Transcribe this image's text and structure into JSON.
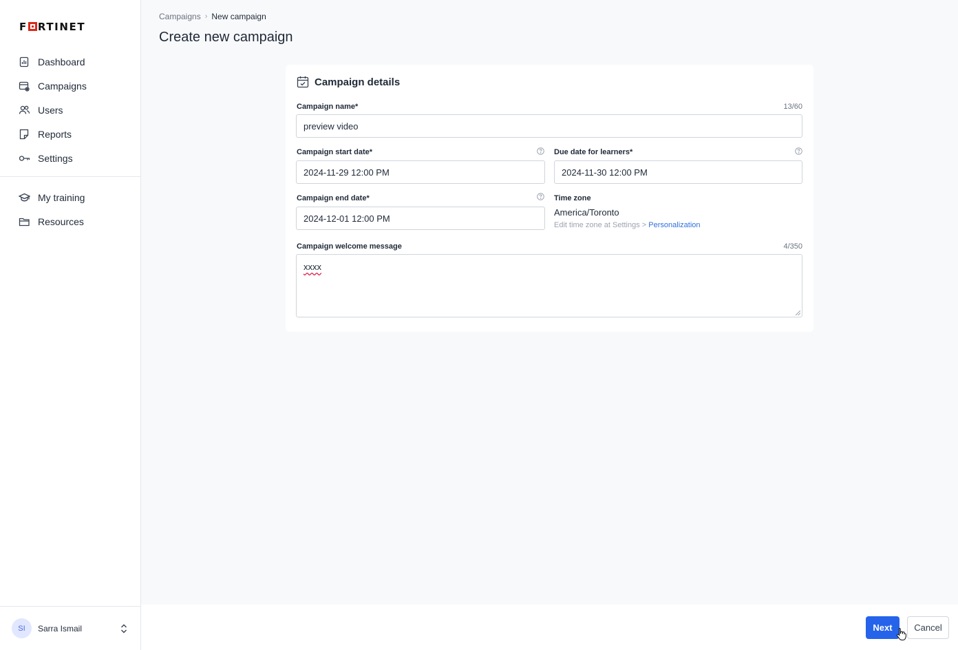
{
  "brand": {
    "logo_text": "FORTINET",
    "accent": "#da291c"
  },
  "sidebar": {
    "items": [
      {
        "label": "Dashboard",
        "icon": "dashboard-icon"
      },
      {
        "label": "Campaigns",
        "icon": "campaigns-icon"
      },
      {
        "label": "Users",
        "icon": "users-icon"
      },
      {
        "label": "Reports",
        "icon": "reports-icon"
      },
      {
        "label": "Settings",
        "icon": "key-icon"
      }
    ],
    "secondary_items": [
      {
        "label": "My training",
        "icon": "graduation-cap-icon"
      },
      {
        "label": "Resources",
        "icon": "folder-icon"
      }
    ],
    "user": {
      "initials": "SI",
      "name": "Sarra Ismail"
    }
  },
  "breadcrumb": {
    "parent": "Campaigns",
    "current": "New campaign"
  },
  "page_title": "Create new campaign",
  "card": {
    "title": "Campaign details",
    "campaign_name": {
      "label": "Campaign name*",
      "value": "preview video",
      "counter": "13/60"
    },
    "start_date": {
      "label": "Campaign start date*",
      "value": "2024-11-29 12:00 PM"
    },
    "due_date": {
      "label": "Due date for learners*",
      "value": "2024-11-30 12:00 PM"
    },
    "end_date": {
      "label": "Campaign end date*",
      "value": "2024-12-01 12:00 PM"
    },
    "time_zone": {
      "label": "Time zone",
      "value": "America/Toronto",
      "hint_prefix": "Edit time zone at Settings > ",
      "hint_link": "Personalization"
    },
    "welcome_message": {
      "label": "Campaign welcome message",
      "value": "xxxx",
      "counter": "4/350"
    }
  },
  "footer": {
    "next_label": "Next",
    "cancel_label": "Cancel",
    "primary_color": "#2563eb"
  }
}
